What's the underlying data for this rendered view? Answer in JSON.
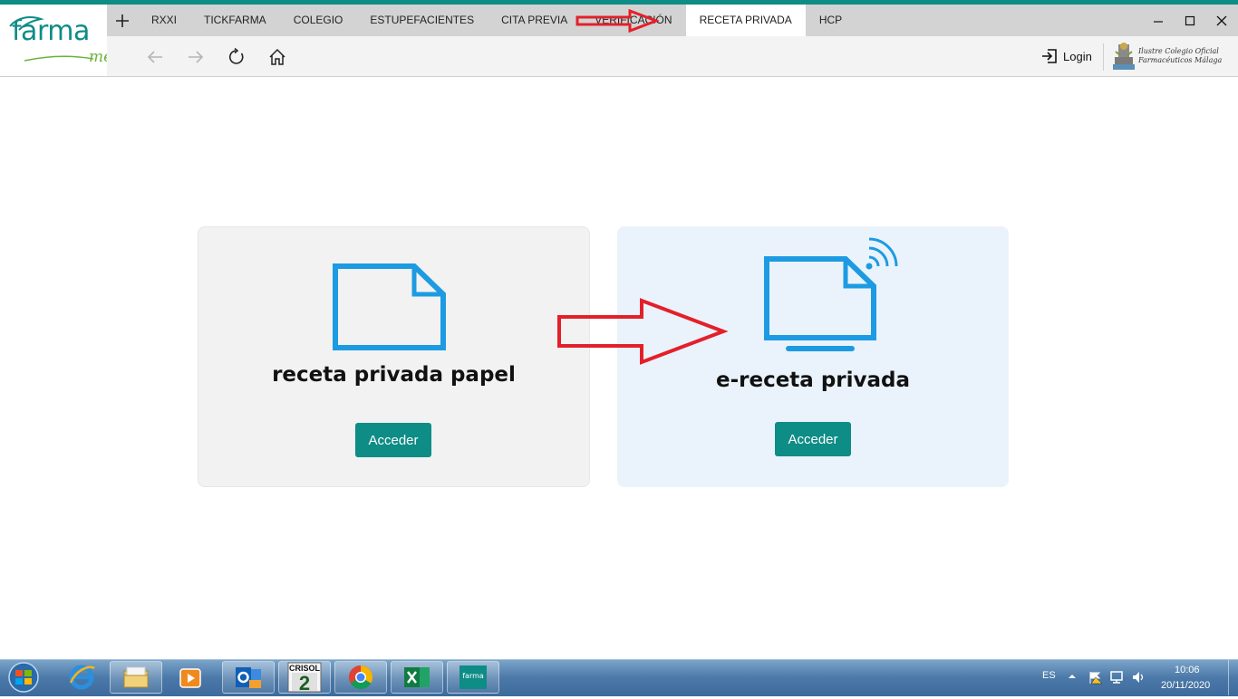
{
  "brand": {
    "logo_main": "farma",
    "logo_sub": "me"
  },
  "tabs": [
    {
      "label": "RXXI",
      "active": false
    },
    {
      "label": "TICKFARMA",
      "active": false
    },
    {
      "label": "COLEGIO",
      "active": false
    },
    {
      "label": "ESTUPEFACIENTES",
      "active": false
    },
    {
      "label": "CITA PREVIA",
      "active": false
    },
    {
      "label": "VERIFICACIÓN",
      "active": false
    },
    {
      "label": "RECETA PRIVADA",
      "active": true
    },
    {
      "label": "HCP",
      "active": false
    }
  ],
  "toolbar": {
    "login_label": "Login"
  },
  "college": {
    "line1": "Ilustre Colegio Oficial",
    "line2": "Farmacéuticos Málaga"
  },
  "cards": [
    {
      "title": "receta privada papel",
      "button_label": "Acceder"
    },
    {
      "title": "e-receta privada",
      "button_label": "Acceder"
    }
  ],
  "taskbar": {
    "apps": [
      "internet-explorer",
      "file-explorer",
      "media-player",
      "outlook",
      "crisol",
      "chrome",
      "excel",
      "farmame"
    ],
    "crisol_label": "CRISOL",
    "crisol_number": "2",
    "farma_label": "farma",
    "language": "ES",
    "time": "10:06",
    "date": "20/11/2020"
  },
  "colors": {
    "accent": "#0e8c86",
    "icon_blue": "#1d9be2",
    "annotation_red": "#e3202a"
  }
}
